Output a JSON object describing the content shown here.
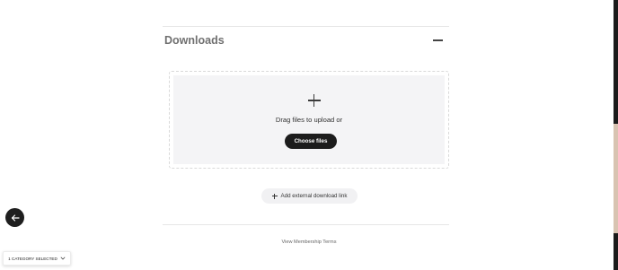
{
  "downloads": {
    "title": "Downloads",
    "collapse_icon": "minus-icon"
  },
  "upload": {
    "add_icon": "plus-icon",
    "drag_text": "Drag files to upload or",
    "choose_label": "Choose files"
  },
  "external_link": {
    "icon": "plus-icon",
    "label": "Add external download link"
  },
  "footer": {
    "terms_label": "View Membership Terms"
  },
  "nav": {
    "back_icon": "arrow-left-icon"
  },
  "category_filter": {
    "label": "1 CATEGORY SELECTED",
    "icon": "chevron-down-icon"
  },
  "colors": {
    "primary_button": "#1c1c1c",
    "dropzone_bg": "#f4f4f6",
    "scroll_thumb": "#d8c3b1"
  }
}
